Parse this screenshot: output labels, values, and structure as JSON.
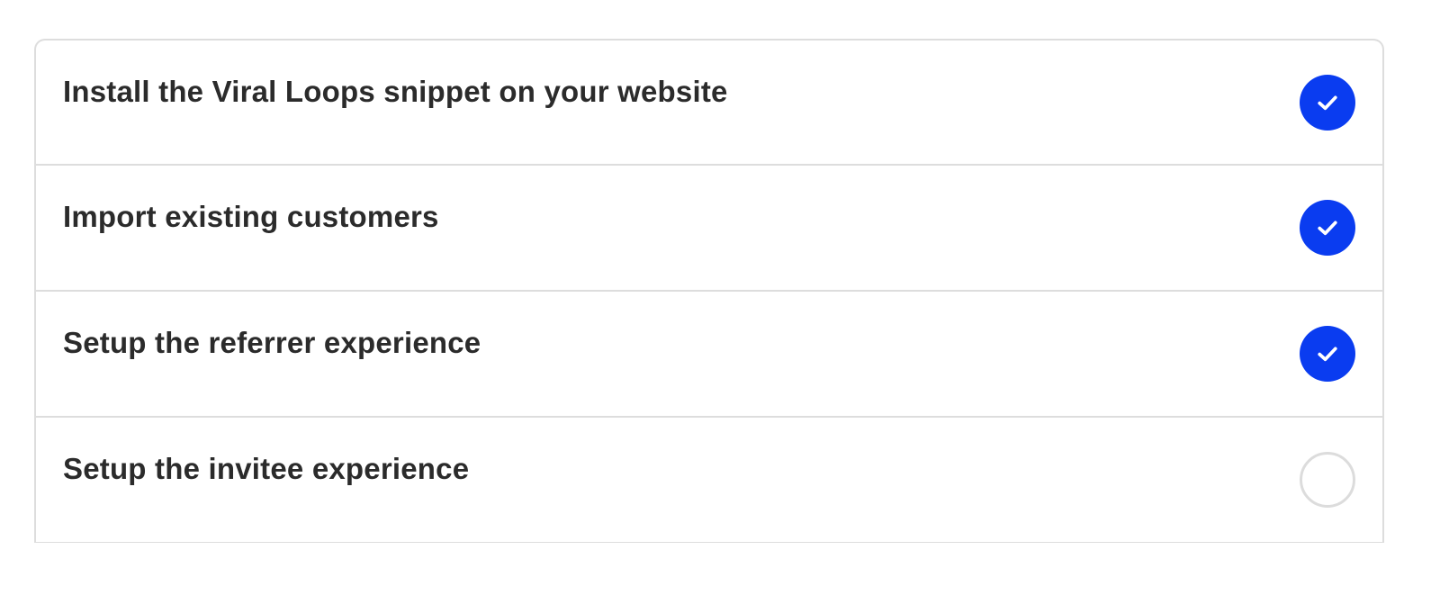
{
  "checklist": {
    "steps": [
      {
        "label": "Install the Viral Loops snippet on your website",
        "completed": true,
        "icon": "check-icon"
      },
      {
        "label": "Import existing customers",
        "completed": true,
        "icon": "check-icon"
      },
      {
        "label": "Setup the referrer experience",
        "completed": true,
        "icon": "check-icon"
      },
      {
        "label": "Setup the invitee experience",
        "completed": false,
        "icon": "empty-circle-icon"
      }
    ]
  },
  "colors": {
    "accent": "#0a3cf0",
    "text": "#2b2b2b",
    "border": "#dddddd",
    "pending_ring": "#dcdcdc"
  }
}
